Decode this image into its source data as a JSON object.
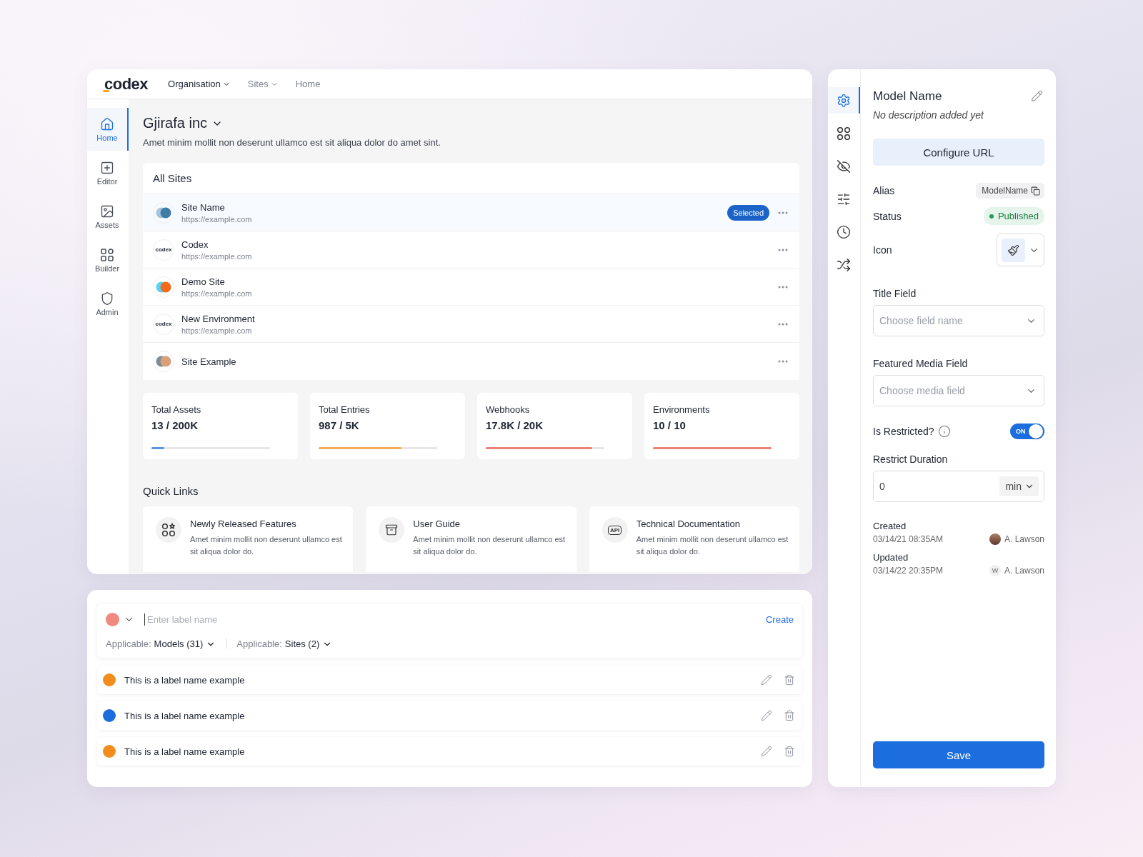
{
  "nav": {
    "logo": "codex",
    "menu": [
      {
        "label": "Organisation",
        "dropdown": true,
        "selected": true
      },
      {
        "label": "Sites",
        "dropdown": true,
        "selected": false
      },
      {
        "label": "Home",
        "dropdown": false,
        "selected": false
      }
    ]
  },
  "sidebar": {
    "items": [
      {
        "label": "Home",
        "kind": "home",
        "selected": true
      },
      {
        "label": "Editor",
        "kind": "editor",
        "selected": false
      },
      {
        "label": "Assets",
        "kind": "assets",
        "selected": false
      },
      {
        "label": "Builder",
        "kind": "builder",
        "selected": false
      },
      {
        "label": "Admin",
        "kind": "admin",
        "selected": false
      }
    ]
  },
  "org": {
    "name": "Gjirafa inc",
    "description": "Amet minim mollit non deserunt ullamco est sit aliqua dolor do amet sint."
  },
  "sites": {
    "title": "All Sites",
    "badge": "Selected",
    "rows": [
      {
        "name": "Site Name",
        "url": "https://example.com",
        "selected": true,
        "logo": {
          "kind": "circles",
          "circles": [
            {
              "color": "#a6c4dc"
            },
            {
              "color": "#3f7ca6"
            }
          ]
        }
      },
      {
        "name": "Codex",
        "url": "https://example.com",
        "selected": false,
        "logo": {
          "kind": "wordmark",
          "text": "codex"
        }
      },
      {
        "name": "Demo Site",
        "url": "https://example.com",
        "selected": false,
        "logo": {
          "kind": "circles",
          "circles": [
            {
              "color": "#55d3f5"
            },
            {
              "color": "#f56a1a"
            }
          ]
        }
      },
      {
        "name": "New Environment",
        "url": "https://example.com",
        "selected": false,
        "logo": {
          "kind": "wordmark",
          "text": "codex"
        }
      },
      {
        "name": "Site Example",
        "selected": false,
        "logo": {
          "kind": "circles",
          "circles": [
            {
              "color": "#7c8d93"
            },
            {
              "color": "#d9a07a"
            }
          ]
        }
      }
    ]
  },
  "stats": [
    {
      "label": "Total Assets",
      "value": "13 / 200K",
      "level": 0.11,
      "color": "#5b93e0"
    },
    {
      "label": "Total Entries",
      "value": "987 / 5K",
      "level": 0.7,
      "color": "#f5ad55"
    },
    {
      "label": "Webhooks",
      "value": "17.8K / 20K",
      "level": 0.9,
      "color": "#ec8276"
    },
    {
      "label": "Environments",
      "value": "10 / 10",
      "level": 1,
      "color": "#ec8276"
    }
  ],
  "quick_links": {
    "title": "Quick Links",
    "items": [
      {
        "title": "Newly Released Features",
        "description": "Amet minim mollit non deserunt ullamco est sit aliqua dolor do.",
        "kind": "features"
      },
      {
        "title": "User Guide",
        "description": "Amet minim mollit non deserunt ullamco est sit aliqua dolor do.",
        "kind": "guide"
      },
      {
        "title": "Technical Documentation",
        "description": "Amet minim mollit non deserunt ullamco est sit aliqua dolor do.",
        "kind": "api",
        "icon_text": "API"
      }
    ]
  },
  "labels": {
    "new_label": {
      "color": "#f08a80",
      "placeholder": "Enter label name",
      "action": "Create",
      "filters": [
        {
          "prefix": "Applicable:",
          "value": "Models (31)"
        },
        {
          "prefix": "Applicable:",
          "value": "Sites (2)"
        }
      ]
    },
    "items": [
      {
        "name": "This is a label name example",
        "color": "#f28c1a"
      },
      {
        "name": "This is a label name example",
        "color": "#1c6ede"
      },
      {
        "name": "This is a label name example",
        "color": "#f28c1a"
      }
    ]
  },
  "inspector": {
    "rail": [
      {
        "kind": "settings",
        "selected": true
      },
      {
        "kind": "grid",
        "selected": false
      },
      {
        "kind": "hidden",
        "selected": false
      },
      {
        "kind": "sliders",
        "selected": false
      },
      {
        "kind": "history",
        "selected": false
      },
      {
        "kind": "shuffle",
        "selected": false
      }
    ],
    "title": "Model Name",
    "description": "No description added yet",
    "configure_button": "Configure URL",
    "alias": {
      "label": "Alias",
      "value": "ModelName"
    },
    "status": {
      "label": "Status",
      "value": "Published"
    },
    "icon_field": {
      "label": "Icon"
    },
    "title_field": {
      "label": "Title Field",
      "placeholder": "Choose field name"
    },
    "media_field": {
      "label": "Featured Media Field",
      "placeholder": "Choose media field"
    },
    "restricted": {
      "label": "Is Restricted?",
      "on": true,
      "on_text": "ON"
    },
    "duration": {
      "label": "Restrict Duration",
      "value": "0",
      "unit": "min"
    },
    "meta": [
      {
        "label": "Created",
        "date": "03/14/21 08:35AM",
        "user": "A. Lawson",
        "avatar": {
          "kind": "photo"
        }
      },
      {
        "label": "Updated",
        "date": "03/14/22 20:35PM",
        "user": "A. Lawson",
        "avatar": {
          "kind": "initial",
          "text": "W"
        }
      }
    ],
    "save": "Save"
  }
}
